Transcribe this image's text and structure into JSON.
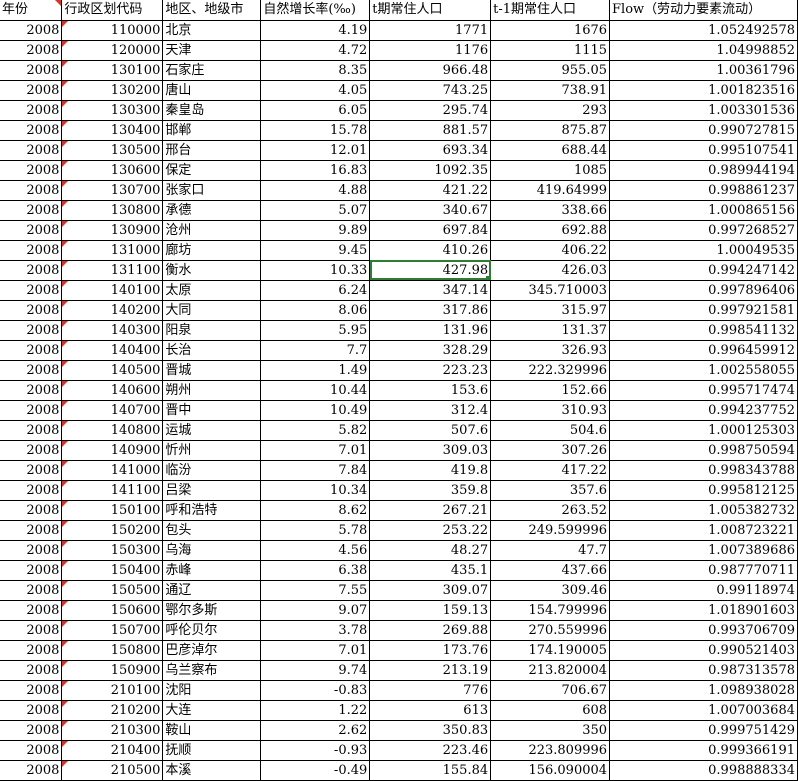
{
  "sheet": {
    "headers": [
      "年份",
      "行政区划代码",
      "地区、地级市",
      "自然增长率(‰)",
      "t期常住人口",
      "t-1期常住人口",
      "Flow（劳动力要素流动）"
    ],
    "rows": [
      [
        "2008",
        "110000",
        "北京",
        "4.19",
        "1771",
        "1676",
        "1.052492578"
      ],
      [
        "2008",
        "120000",
        "天津",
        "4.72",
        "1176",
        "1115",
        "1.04998852"
      ],
      [
        "2008",
        "130100",
        "石家庄",
        "8.35",
        "966.48",
        "955.05",
        "1.00361796"
      ],
      [
        "2008",
        "130200",
        "唐山",
        "4.05",
        "743.25",
        "738.91",
        "1.001823516"
      ],
      [
        "2008",
        "130300",
        "秦皇岛",
        "6.05",
        "295.74",
        "293",
        "1.003301536"
      ],
      [
        "2008",
        "130400",
        "邯郸",
        "15.78",
        "881.57",
        "875.87",
        "0.990727815"
      ],
      [
        "2008",
        "130500",
        "邢台",
        "12.01",
        "693.34",
        "688.44",
        "0.995107541"
      ],
      [
        "2008",
        "130600",
        "保定",
        "16.83",
        "1092.35",
        "1085",
        "0.989944194"
      ],
      [
        "2008",
        "130700",
        "张家口",
        "4.88",
        "421.22",
        "419.64999",
        "0.998861237"
      ],
      [
        "2008",
        "130800",
        "承德",
        "5.07",
        "340.67",
        "338.66",
        "1.000865156"
      ],
      [
        "2008",
        "130900",
        "沧州",
        "9.89",
        "697.84",
        "692.88",
        "0.997268527"
      ],
      [
        "2008",
        "131000",
        "廊坊",
        "9.45",
        "410.26",
        "406.22",
        "1.00049535"
      ],
      [
        "2008",
        "131100",
        "衡水",
        "10.33",
        "427.98",
        "426.03",
        "0.994247142"
      ],
      [
        "2008",
        "140100",
        "太原",
        "6.24",
        "347.14",
        "345.710003",
        "0.997896406"
      ],
      [
        "2008",
        "140200",
        "大同",
        "8.06",
        "317.86",
        "315.97",
        "0.997921581"
      ],
      [
        "2008",
        "140300",
        "阳泉",
        "5.95",
        "131.96",
        "131.37",
        "0.998541132"
      ],
      [
        "2008",
        "140400",
        "长治",
        "7.7",
        "328.29",
        "326.93",
        "0.996459912"
      ],
      [
        "2008",
        "140500",
        "晋城",
        "1.49",
        "223.23",
        "222.329996",
        "1.002558055"
      ],
      [
        "2008",
        "140600",
        "朔州",
        "10.44",
        "153.6",
        "152.66",
        "0.995717474"
      ],
      [
        "2008",
        "140700",
        "晋中",
        "10.49",
        "312.4",
        "310.93",
        "0.994237752"
      ],
      [
        "2008",
        "140800",
        "运城",
        "5.82",
        "507.6",
        "504.6",
        "1.000125303"
      ],
      [
        "2008",
        "140900",
        "忻州",
        "7.01",
        "309.03",
        "307.26",
        "0.998750594"
      ],
      [
        "2008",
        "141000",
        "临汾",
        "7.84",
        "419.8",
        "417.22",
        "0.998343788"
      ],
      [
        "2008",
        "141100",
        "吕梁",
        "10.34",
        "359.8",
        "357.6",
        "0.995812125"
      ],
      [
        "2008",
        "150100",
        "呼和浩特",
        "8.62",
        "267.21",
        "263.52",
        "1.005382732"
      ],
      [
        "2008",
        "150200",
        "包头",
        "5.78",
        "253.22",
        "249.599996",
        "1.008723221"
      ],
      [
        "2008",
        "150300",
        "乌海",
        "4.56",
        "48.27",
        "47.7",
        "1.007389686"
      ],
      [
        "2008",
        "150400",
        "赤峰",
        "6.38",
        "435.1",
        "437.66",
        "0.987770711"
      ],
      [
        "2008",
        "150500",
        "通辽",
        "7.55",
        "309.07",
        "309.46",
        "0.99118974"
      ],
      [
        "2008",
        "150600",
        "鄂尔多斯",
        "9.07",
        "159.13",
        "154.799996",
        "1.018901603"
      ],
      [
        "2008",
        "150700",
        "呼伦贝尔",
        "3.78",
        "269.88",
        "270.559996",
        "0.993706709"
      ],
      [
        "2008",
        "150800",
        "巴彦淖尔",
        "7.01",
        "173.76",
        "174.190005",
        "0.990521403"
      ],
      [
        "2008",
        "150900",
        "乌兰察布",
        "9.74",
        "213.19",
        "213.820004",
        "0.987313578"
      ],
      [
        "2008",
        "210100",
        "沈阳",
        "-0.83",
        "776",
        "706.67",
        "1.098938028"
      ],
      [
        "2008",
        "210200",
        "大连",
        "1.22",
        "613",
        "608",
        "1.007003684"
      ],
      [
        "2008",
        "210300",
        "鞍山",
        "2.62",
        "350.83",
        "350",
        "0.999751429"
      ],
      [
        "2008",
        "210400",
        "抚顺",
        "-0.93",
        "223.46",
        "223.809996",
        "0.999366191"
      ],
      [
        "2008",
        "210500",
        "本溪",
        "-0.49",
        "155.84",
        "156.090004",
        "0.998888334"
      ]
    ],
    "selected": {
      "row": 12,
      "col": 4
    },
    "colors": {
      "selection": "#2e7d32",
      "comment_flag": "#d9342b"
    }
  }
}
